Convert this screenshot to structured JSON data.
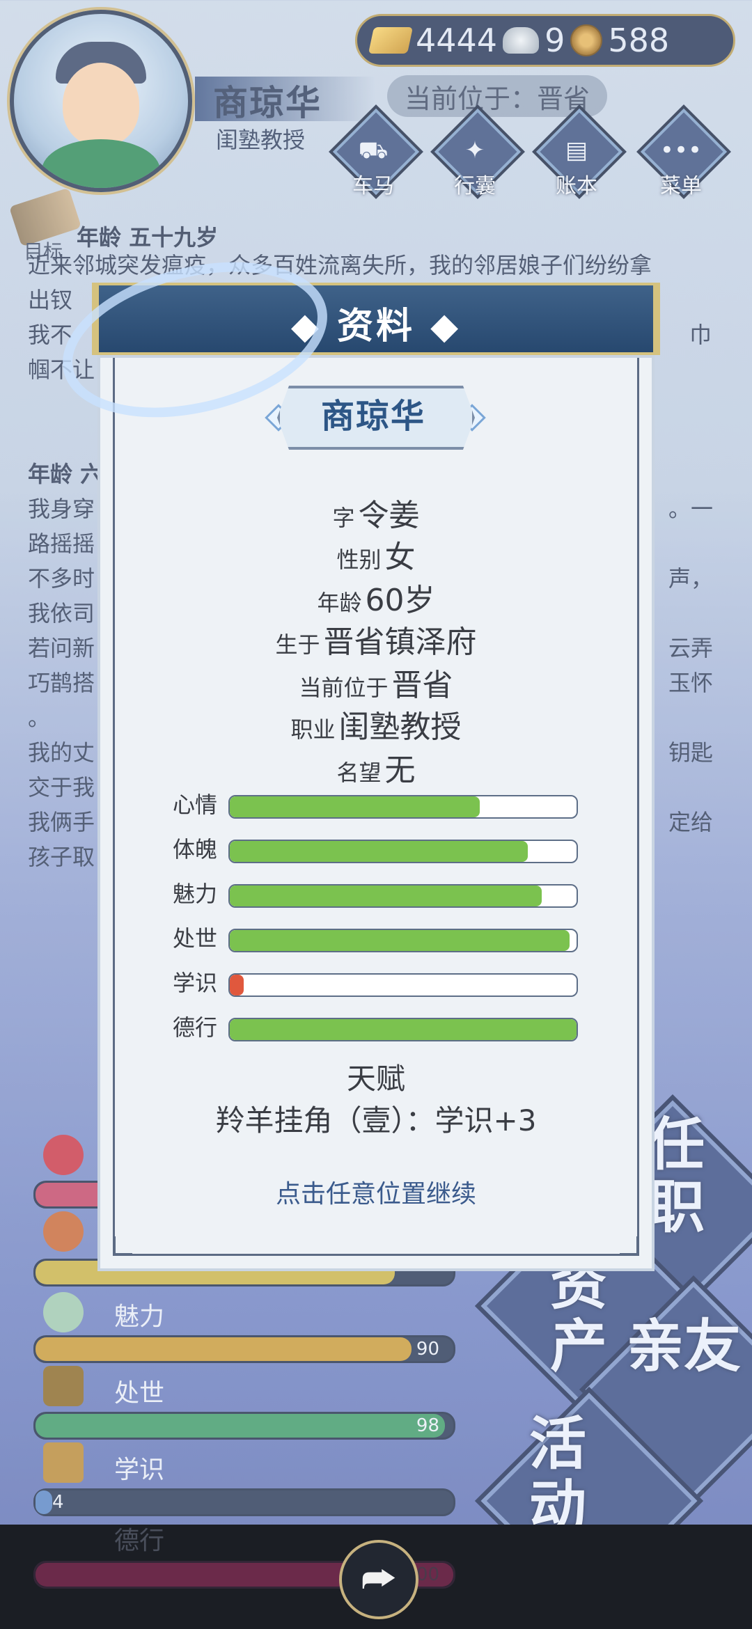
{
  "header": {
    "character_name": "商琼华",
    "job": "闺塾教授",
    "location": "当前位于：晋省",
    "currency": [
      {
        "icon": "gold-ingot-icon",
        "value": "4444"
      },
      {
        "icon": "silver-ingot-icon",
        "value": "9"
      },
      {
        "icon": "copper-coin-icon",
        "value": "588"
      }
    ]
  },
  "nav": [
    {
      "label": "车马",
      "icon": "carriage-icon"
    },
    {
      "label": "行囊",
      "icon": "bag-icon"
    },
    {
      "label": "账本",
      "icon": "ledger-icon"
    },
    {
      "label": "菜单",
      "icon": "more-icon"
    }
  ],
  "target": {
    "label": "目标"
  },
  "story": {
    "age_heading": "年龄 五十九岁",
    "lines": [
      "近来邻城突发瘟疫，众多百姓流离失所，我的邻居娘子们纷纷拿",
      "出钗",
      "我不",
      "帼不让",
      "年龄 六",
      "我身穿",
      "路摇摇",
      "不多时",
      "我依司",
      "若问新",
      "巧鹊搭",
      "。",
      "我的丈",
      "交于我",
      "我俩手",
      "孩子取"
    ],
    "right_fragments": [
      "巾",
      "。一",
      "声，",
      "云弄",
      "玉怀",
      "钥匙",
      "定给"
    ]
  },
  "bg_stats": [
    {
      "name": "魅力",
      "value": "90",
      "percent": 90,
      "color": "#c79a3a"
    },
    {
      "name": "处世",
      "value": "98",
      "percent": 98,
      "color": "#3f9a6a"
    },
    {
      "name": "学识",
      "value": "4",
      "percent": 4,
      "color": "#5a86c5"
    },
    {
      "name": "德行",
      "value": "100",
      "percent": 100,
      "color": "#6b2a4a"
    }
  ],
  "bg_diamonds": [
    "任职",
    "资产",
    "亲友",
    "活动"
  ],
  "modal": {
    "title": "资料",
    "name": "商琼华",
    "fields": [
      {
        "key": "字",
        "value": "令姜"
      },
      {
        "key": "性别",
        "value": "女"
      },
      {
        "key": "年龄",
        "value": "60岁"
      },
      {
        "key": "生于",
        "value": "晋省镇泽府"
      },
      {
        "key": "当前位于",
        "value": "晋省"
      },
      {
        "key": "职业",
        "value": "闺塾教授"
      },
      {
        "key": "名望",
        "value": "无"
      }
    ],
    "bars": [
      {
        "label": "心情",
        "percent": 72,
        "color": "#7bc24f"
      },
      {
        "label": "体魄",
        "percent": 86,
        "color": "#7bc24f"
      },
      {
        "label": "魅力",
        "percent": 90,
        "color": "#7bc24f"
      },
      {
        "label": "处世",
        "percent": 98,
        "color": "#7bc24f"
      },
      {
        "label": "学识",
        "percent": 4,
        "color": "#e0583d"
      },
      {
        "label": "德行",
        "percent": 100,
        "color": "#7bc24f"
      }
    ],
    "talent_title": "天赋",
    "talent_desc": "羚羊挂角（壹）：学识+3",
    "continue_hint": "点击任意位置继续"
  },
  "footer": {
    "share_icon": "share-icon"
  }
}
